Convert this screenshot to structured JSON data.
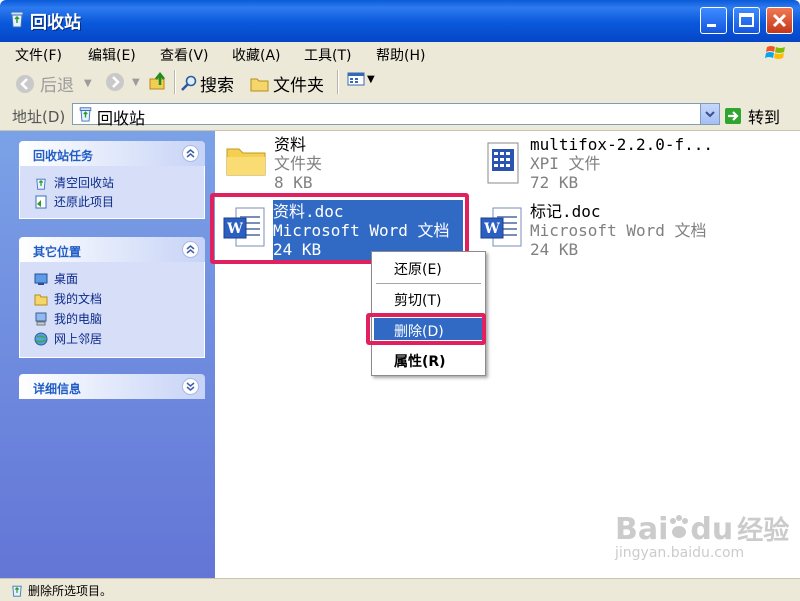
{
  "window": {
    "title": "回收站",
    "icon": "recycle-bin-icon"
  },
  "menubar": {
    "items": [
      "文件(F)",
      "编辑(E)",
      "查看(V)",
      "收藏(A)",
      "工具(T)",
      "帮助(H)"
    ]
  },
  "toolbar": {
    "back_label": "后退",
    "search_label": "搜索",
    "folders_label": "文件夹"
  },
  "address": {
    "label": "地址(D)",
    "value": "回收站",
    "go_label": "转到"
  },
  "left_panels": {
    "tasks": {
      "title": "回收站任务",
      "links": [
        "清空回收站",
        "还原此项目"
      ]
    },
    "other_places": {
      "title": "其它位置",
      "links": [
        "桌面",
        "我的文档",
        "我的电脑",
        "网上邻居"
      ]
    },
    "details": {
      "title": "详细信息"
    }
  },
  "files": [
    {
      "name": "资料",
      "type": "文件夹",
      "size": "8 KB",
      "icon": "folder-icon"
    },
    {
      "name": "multifox-2.2.0-f...",
      "type": "XPI 文件",
      "size": "72 KB",
      "icon": "xpi-file-icon"
    },
    {
      "name": "资料.doc",
      "type": "Microsoft Word 文档",
      "size": "24 KB",
      "icon": "word-doc-icon"
    },
    {
      "name": "标记.doc",
      "type": "Microsoft Word 文档",
      "size": "24 KB",
      "icon": "word-doc-icon"
    }
  ],
  "context_menu": {
    "restore": "还原(E)",
    "cut": "剪切(T)",
    "delete": "删除(D)",
    "properties": "属性(R)"
  },
  "status": {
    "text": "删除所选项目。"
  },
  "watermark": {
    "brand": "Bai",
    "brand2": "du",
    "brand3": "经验",
    "url": "jingyan.baidu.com"
  },
  "colors": {
    "titlebar": "#0a58dc",
    "selection": "#316ac5",
    "highlight": "#e0215d",
    "panel_title": "#215dc6"
  }
}
